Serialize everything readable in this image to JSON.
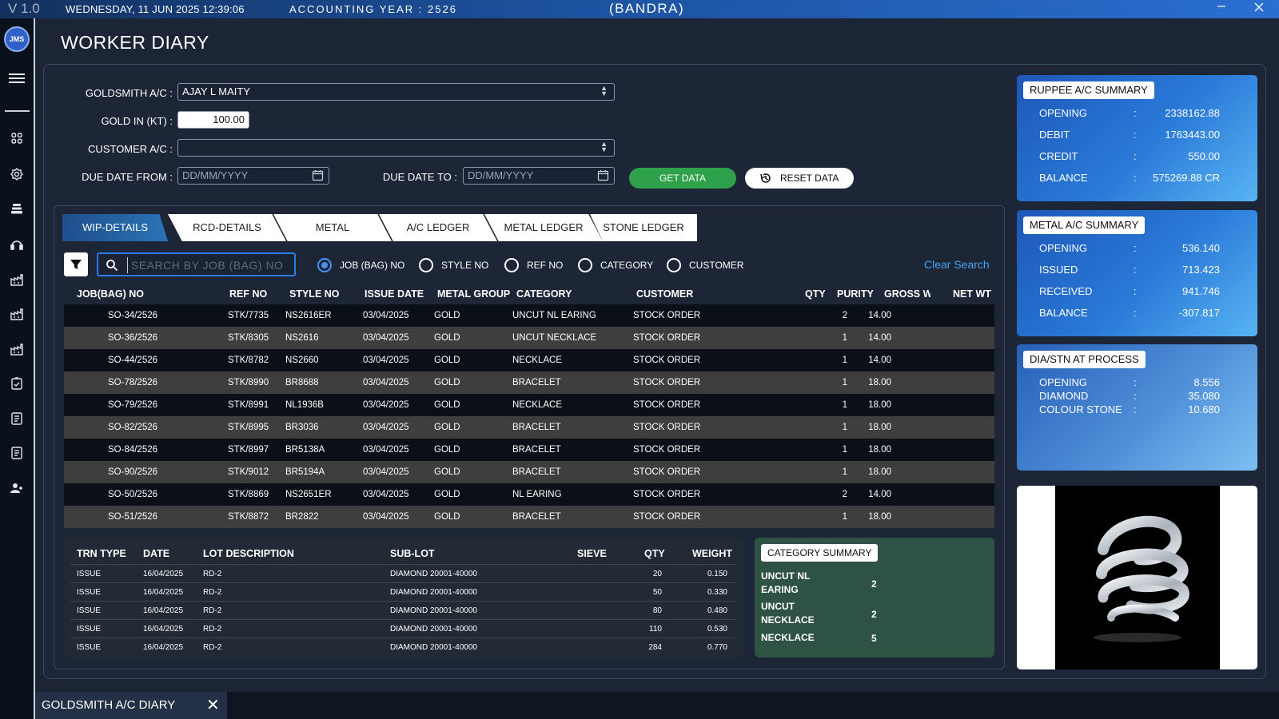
{
  "titlebar": {
    "version": "V 1.0",
    "datetime": "WEDNESDAY, 11 JUN 2025   12:39:06",
    "accounting_year": "ACCOUNTING YEAR : 2526",
    "branch": "(BANDRA)",
    "minimize_icon": "minimize-icon",
    "close_icon": "close-icon"
  },
  "sidebar": {
    "avatar": "JMS",
    "icons": [
      "menu-icon",
      "dashboard-icon",
      "settings-icon",
      "stack-icon",
      "support-icon",
      "factory-icon",
      "factory-icon",
      "factory-icon",
      "checklist-icon",
      "document-icon",
      "document-icon",
      "user-group-icon"
    ]
  },
  "page_title": "WORKER DIARY",
  "form": {
    "goldsmith_label": "GOLDSMITH A/C :",
    "goldsmith_value": "AJAY L MAITY",
    "gold_kt_label": "GOLD IN (KT) :",
    "gold_kt_value": "100.00",
    "customer_label": "CUSTOMER A/C :",
    "customer_value": "",
    "due_from_label": "DUE DATE FROM :",
    "due_from_placeholder": "DD/MM/YYYY",
    "due_to_label": "DUE DATE TO :",
    "due_to_placeholder": "DD/MM/YYYY",
    "get_data": "GET DATA",
    "reset_data": "RESET DATA"
  },
  "tabs": [
    "WIP-DETAILS",
    "RCD-DETAILS",
    "METAL",
    "A/C LEDGER",
    "METAL LEDGER",
    "STONE LEDGER"
  ],
  "search": {
    "placeholder": "SEARCH BY JOB (BAG) NO",
    "options": [
      "JOB (BAG) NO",
      "STYLE NO",
      "REF NO",
      "CATEGORY",
      "CUSTOMER"
    ],
    "selected": "JOB (BAG) NO",
    "clear": "Clear Search"
  },
  "wip_table": {
    "columns": [
      "JOB(BAG) NO",
      "REF NO",
      "STYLE NO",
      "ISSUE DATE",
      "METAL GROUP",
      "CATEGORY",
      "CUSTOMER",
      "QTY",
      "PURITY",
      "GROSS WT",
      "NET WT"
    ],
    "rows": [
      [
        "SO-34/2526",
        "STK/7735",
        "NS2616ER",
        "03/04/2025",
        "GOLD",
        "UNCUT NL EARING",
        "STOCK ORDER",
        "2",
        "14.00",
        "",
        ""
      ],
      [
        "SO-36/2526",
        "STK/8305",
        "NS2616",
        "03/04/2025",
        "GOLD",
        "UNCUT NECKLACE",
        "STOCK ORDER",
        "1",
        "14.00",
        "",
        ""
      ],
      [
        "SO-44/2526",
        "STK/8782",
        "NS2660",
        "03/04/2025",
        "GOLD",
        "NECKLACE",
        "STOCK ORDER",
        "1",
        "14.00",
        "",
        ""
      ],
      [
        "SO-78/2526",
        "STK/8990",
        "BR8688",
        "03/04/2025",
        "GOLD",
        "BRACELET",
        "STOCK ORDER",
        "1",
        "18.00",
        "",
        ""
      ],
      [
        "SO-79/2526",
        "STK/8991",
        "NL1936B",
        "03/04/2025",
        "GOLD",
        "NECKLACE",
        "STOCK ORDER",
        "1",
        "18.00",
        "",
        ""
      ],
      [
        "SO-82/2526",
        "STK/8995",
        "BR3036",
        "03/04/2025",
        "GOLD",
        "BRACELET",
        "STOCK ORDER",
        "1",
        "18.00",
        "",
        ""
      ],
      [
        "SO-84/2526",
        "STK/8997",
        "BR5138A",
        "03/04/2025",
        "GOLD",
        "BRACELET",
        "STOCK ORDER",
        "1",
        "18.00",
        "",
        ""
      ],
      [
        "SO-90/2526",
        "STK/9012",
        "BR5194A",
        "03/04/2025",
        "GOLD",
        "BRACELET",
        "STOCK ORDER",
        "1",
        "18.00",
        "",
        ""
      ],
      [
        "SO-50/2526",
        "STK/8869",
        "NS2651ER",
        "03/04/2025",
        "GOLD",
        "NL EARING",
        "STOCK ORDER",
        "2",
        "14.00",
        "",
        ""
      ],
      [
        "SO-51/2526",
        "STK/8872",
        "BR2822",
        "03/04/2025",
        "GOLD",
        "BRACELET",
        "STOCK ORDER",
        "1",
        "18.00",
        "",
        ""
      ]
    ]
  },
  "stone_table": {
    "columns": [
      "TRN TYPE",
      "DATE",
      "LOT DESCRIPTION",
      "SUB-LOT",
      "SIEVE",
      "QTY",
      "WEIGHT"
    ],
    "rows": [
      [
        "ISSUE",
        "16/04/2025",
        "RD-2",
        "DIAMOND 20001-40000",
        "",
        "20",
        "0.150"
      ],
      [
        "ISSUE",
        "16/04/2025",
        "RD-2",
        "DIAMOND 20001-40000",
        "",
        "50",
        "0.330"
      ],
      [
        "ISSUE",
        "16/04/2025",
        "RD-2",
        "DIAMOND 20001-40000",
        "",
        "80",
        "0.480"
      ],
      [
        "ISSUE",
        "16/04/2025",
        "RD-2",
        "DIAMOND 20001-40000",
        "",
        "110",
        "0.530"
      ],
      [
        "ISSUE",
        "16/04/2025",
        "RD-2",
        "DIAMOND 20001-40000",
        "",
        "284",
        "0.770"
      ]
    ]
  },
  "category_summary": {
    "title": "CATEGORY SUMMARY",
    "items": [
      {
        "label": "UNCUT NL EARING",
        "value": "2"
      },
      {
        "label": "UNCUT NECKLACE",
        "value": "2"
      },
      {
        "label": "NECKLACE",
        "value": "5"
      }
    ]
  },
  "rupee_summary": {
    "title": "RUPPEE A/C SUMMARY",
    "rows": [
      {
        "label": "OPENING",
        "value": "2338162.88"
      },
      {
        "label": "DEBIT",
        "value": "1763443.00"
      },
      {
        "label": "CREDIT",
        "value": "550.00"
      },
      {
        "label": "BALANCE",
        "value": "575269.88 CR"
      }
    ]
  },
  "metal_summary": {
    "title": "METAL A/C SUMMARY",
    "rows": [
      {
        "label": "OPENING",
        "value": "536.140"
      },
      {
        "label": "ISSUED",
        "value": "713.423"
      },
      {
        "label": "RECEIVED",
        "value": "941.746"
      },
      {
        "label": "BALANCE",
        "value": "-307.817"
      }
    ]
  },
  "dia_summary": {
    "title": "DIA/STN AT PROCESS",
    "rows": [
      {
        "label": "OPENING",
        "value": "8.556"
      },
      {
        "label": "DIAMOND",
        "value": "35.080"
      },
      {
        "label": "COLOUR STONE",
        "value": "10.680"
      }
    ]
  },
  "colon": ":",
  "bottom_tab": {
    "label": "GOLDSMITH A/C DIARY",
    "close": "✕"
  }
}
